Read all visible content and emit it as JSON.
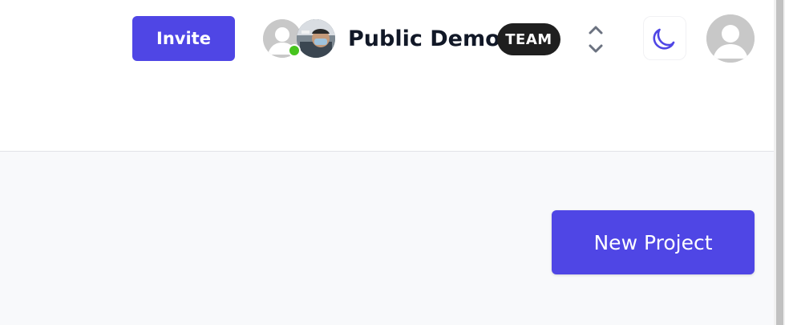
{
  "header": {
    "invite_label": "Invite",
    "team": {
      "name": "Public Demo",
      "badge": "TEAM"
    },
    "members": [
      {
        "avatar": "default-avatar-icon",
        "status": "online"
      },
      {
        "avatar": "photo-avatar"
      }
    ],
    "icons": {
      "switcher": "chevron-up-down-icon",
      "theme": "moon-icon",
      "profile": "user-avatar-icon"
    }
  },
  "main": {
    "new_project_label": "New Project"
  },
  "colors": {
    "accent": "#4f46e5",
    "badge_bg": "#1f1f1f",
    "online": "#47c41e",
    "main_bg": "#f8f9fb"
  }
}
